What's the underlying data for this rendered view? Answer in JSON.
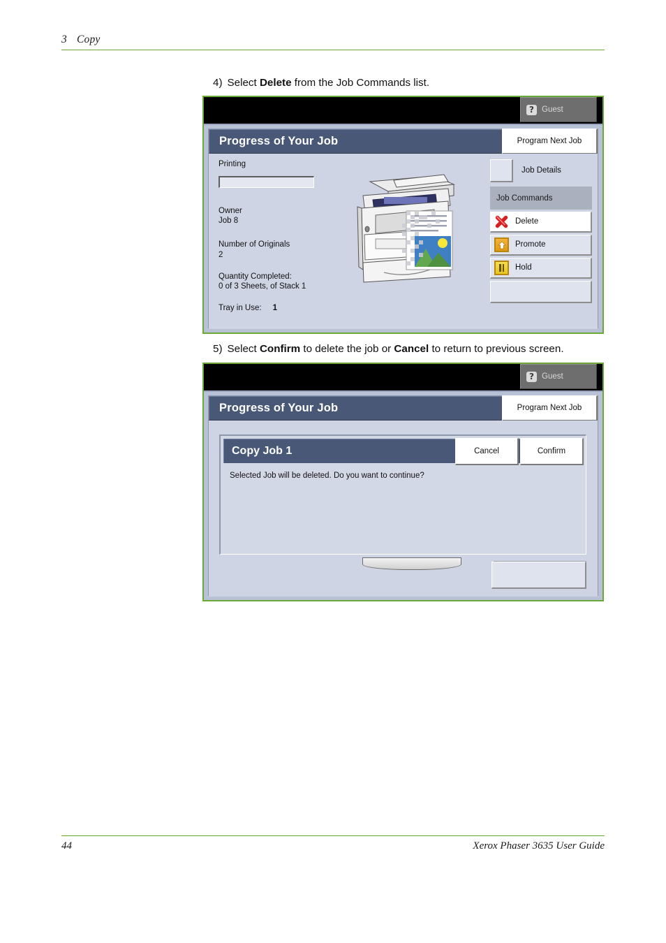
{
  "page": {
    "header": {
      "chapter_number": "3",
      "chapter_title": "Copy"
    },
    "footer": {
      "page_number": "44",
      "guide_title": "Xerox Phaser 3635 User Guide"
    },
    "accent_color": "#6aa838"
  },
  "steps": [
    {
      "marker": "4)",
      "text_before": "Select ",
      "bold1": "Delete",
      "text_middle": " from the Job Commands list.",
      "bold2": "",
      "text_after": ""
    },
    {
      "marker": "5)",
      "text_before": "Select ",
      "bold1": "Confirm",
      "text_middle": " to delete the job or ",
      "bold2": "Cancel",
      "text_after": " to return to previous screen."
    }
  ],
  "screenshot1": {
    "topbar": {
      "guest_label": "Guest",
      "guest_icon": "question-mark-icon"
    },
    "title": "Progress of Your Job",
    "program_next_job": "Program Next Job",
    "status": {
      "state": "Printing",
      "progress_percent": 0,
      "owner_label": "Owner",
      "owner_value": "Job 8",
      "originals_label": "Number of Originals",
      "originals_value": "2",
      "quantity_label": "Quantity Completed:",
      "quantity_value": "0 of 3 Sheets, of Stack 1",
      "tray_label": "Tray in Use:",
      "tray_value": "1"
    },
    "job_details_label": "Job Details",
    "job_commands_header": "Job Commands",
    "commands": [
      {
        "label": "Delete",
        "icon": "red-x-icon",
        "selected": true
      },
      {
        "label": "Promote",
        "icon": "up-arrow-icon",
        "selected": false
      },
      {
        "label": "Hold",
        "icon": "pause-icon",
        "selected": false
      },
      {
        "label": "",
        "icon": "",
        "selected": false
      }
    ],
    "printer_illustration": "xerox-multifunction-printer-with-output-page"
  },
  "screenshot2": {
    "topbar": {
      "guest_label": "Guest",
      "guest_icon": "question-mark-icon"
    },
    "title": "Progress of Your Job",
    "program_next_job": "Program Next Job",
    "dialog": {
      "title": "Copy Job 1",
      "cancel_label": "Cancel",
      "confirm_label": "Confirm",
      "message": "Selected Job will be deleted. Do you want to continue?"
    }
  },
  "colors": {
    "title_bar": "#4a5878",
    "ui_background": "#ced4e4",
    "topbar": "#000000",
    "guest_button": "#6e6e6e",
    "command_header": "#aab0bd",
    "delete_icon": "#d81f1f",
    "promote_icon": "#e8a020",
    "hold_icon": "#eed22a"
  }
}
